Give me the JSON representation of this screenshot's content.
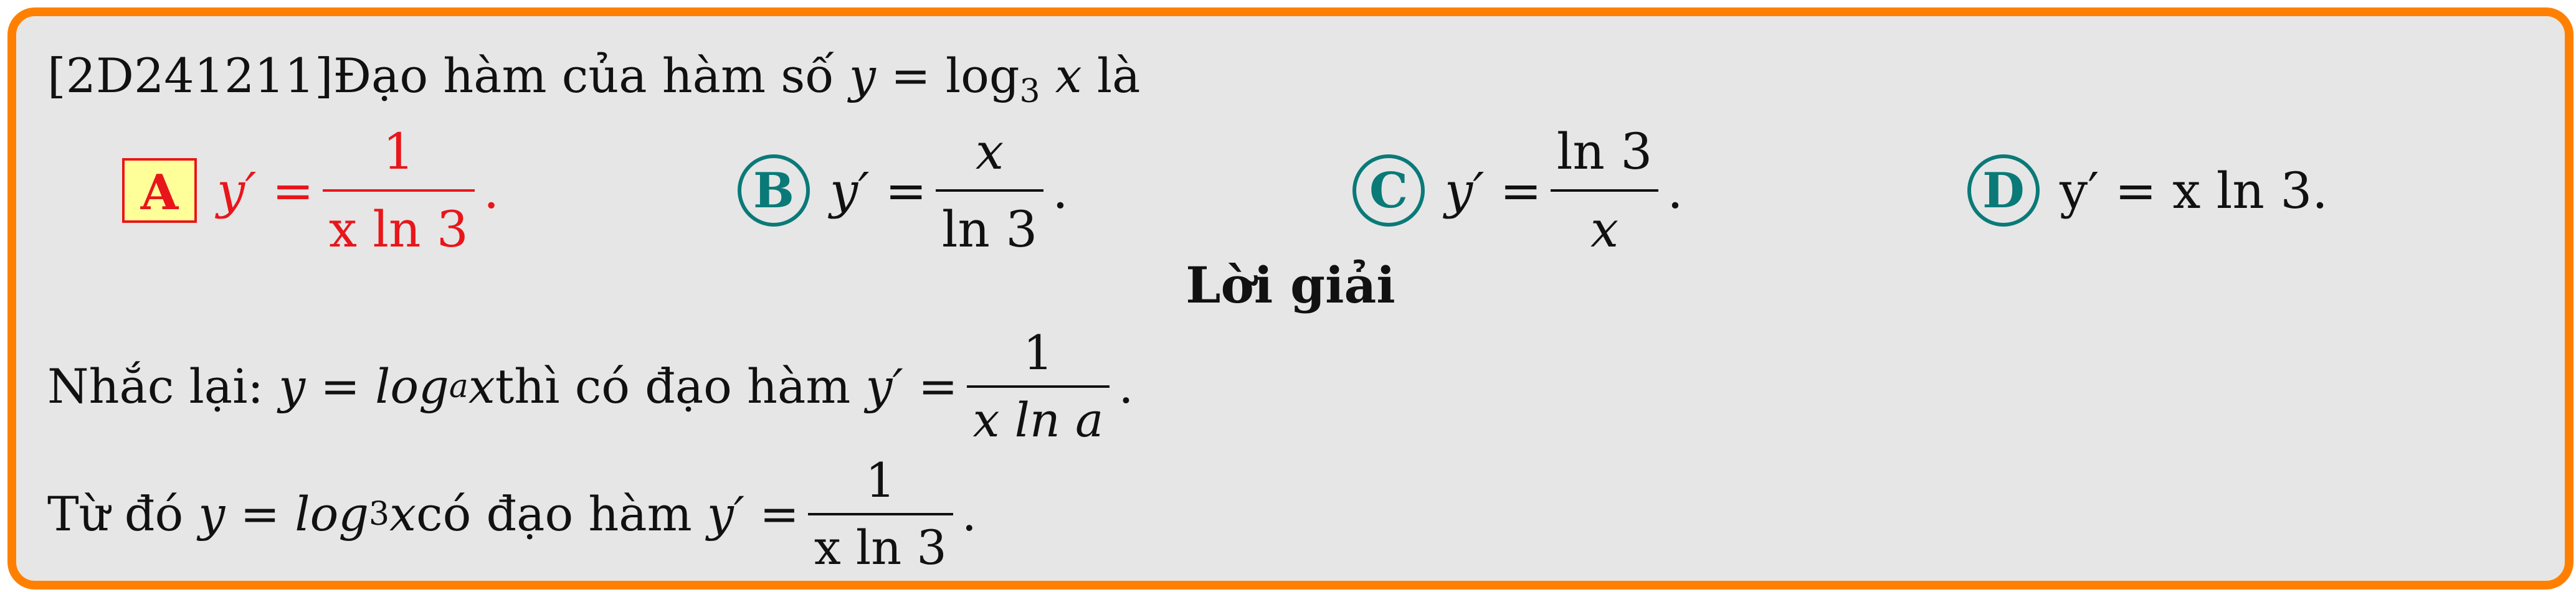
{
  "question": {
    "prefix": "[2D241211]Đạo hàm của hàm số ",
    "func_y": "y",
    "func_eq": " = log",
    "func_base": "3",
    "func_x": " x",
    "suffix": " là"
  },
  "options": [
    {
      "letter": "A",
      "lhs": "y′ = ",
      "num": "1",
      "den": "x ln 3",
      "tail": ".",
      "correct": true
    },
    {
      "letter": "B",
      "lhs": "y′ = ",
      "num": "x",
      "den": "ln 3",
      "tail": ".",
      "correct": false
    },
    {
      "letter": "C",
      "lhs": "y′ = ",
      "num": "ln 3",
      "den": "x",
      "tail": ".",
      "correct": false
    },
    {
      "letter": "D",
      "text": "y′ = x ln 3.",
      "correct": false
    }
  ],
  "solution": {
    "title": "Lời giải",
    "line1": {
      "text_a": "Nhắc lại: ",
      "y_eq": "y = log",
      "base": "a",
      "x_part": " x",
      "text_b": " thì có đạo hàm ",
      "deriv": "y′ = ",
      "num": "1",
      "den": "x ln a",
      "tail": "."
    },
    "line2": {
      "text_a": "Từ đó ",
      "y_eq": "y = log",
      "base": "3",
      "x_part": " x",
      "text_b": " có đạo hàm ",
      "deriv": "y′ = ",
      "num": "1",
      "den": "x ln 3",
      "tail": "."
    }
  },
  "colors": {
    "border": "#ff8000",
    "background": "#e6e6e6",
    "correct": "#e8161b",
    "option_marker": "#0a7a78",
    "highlight": "#ffff99"
  }
}
